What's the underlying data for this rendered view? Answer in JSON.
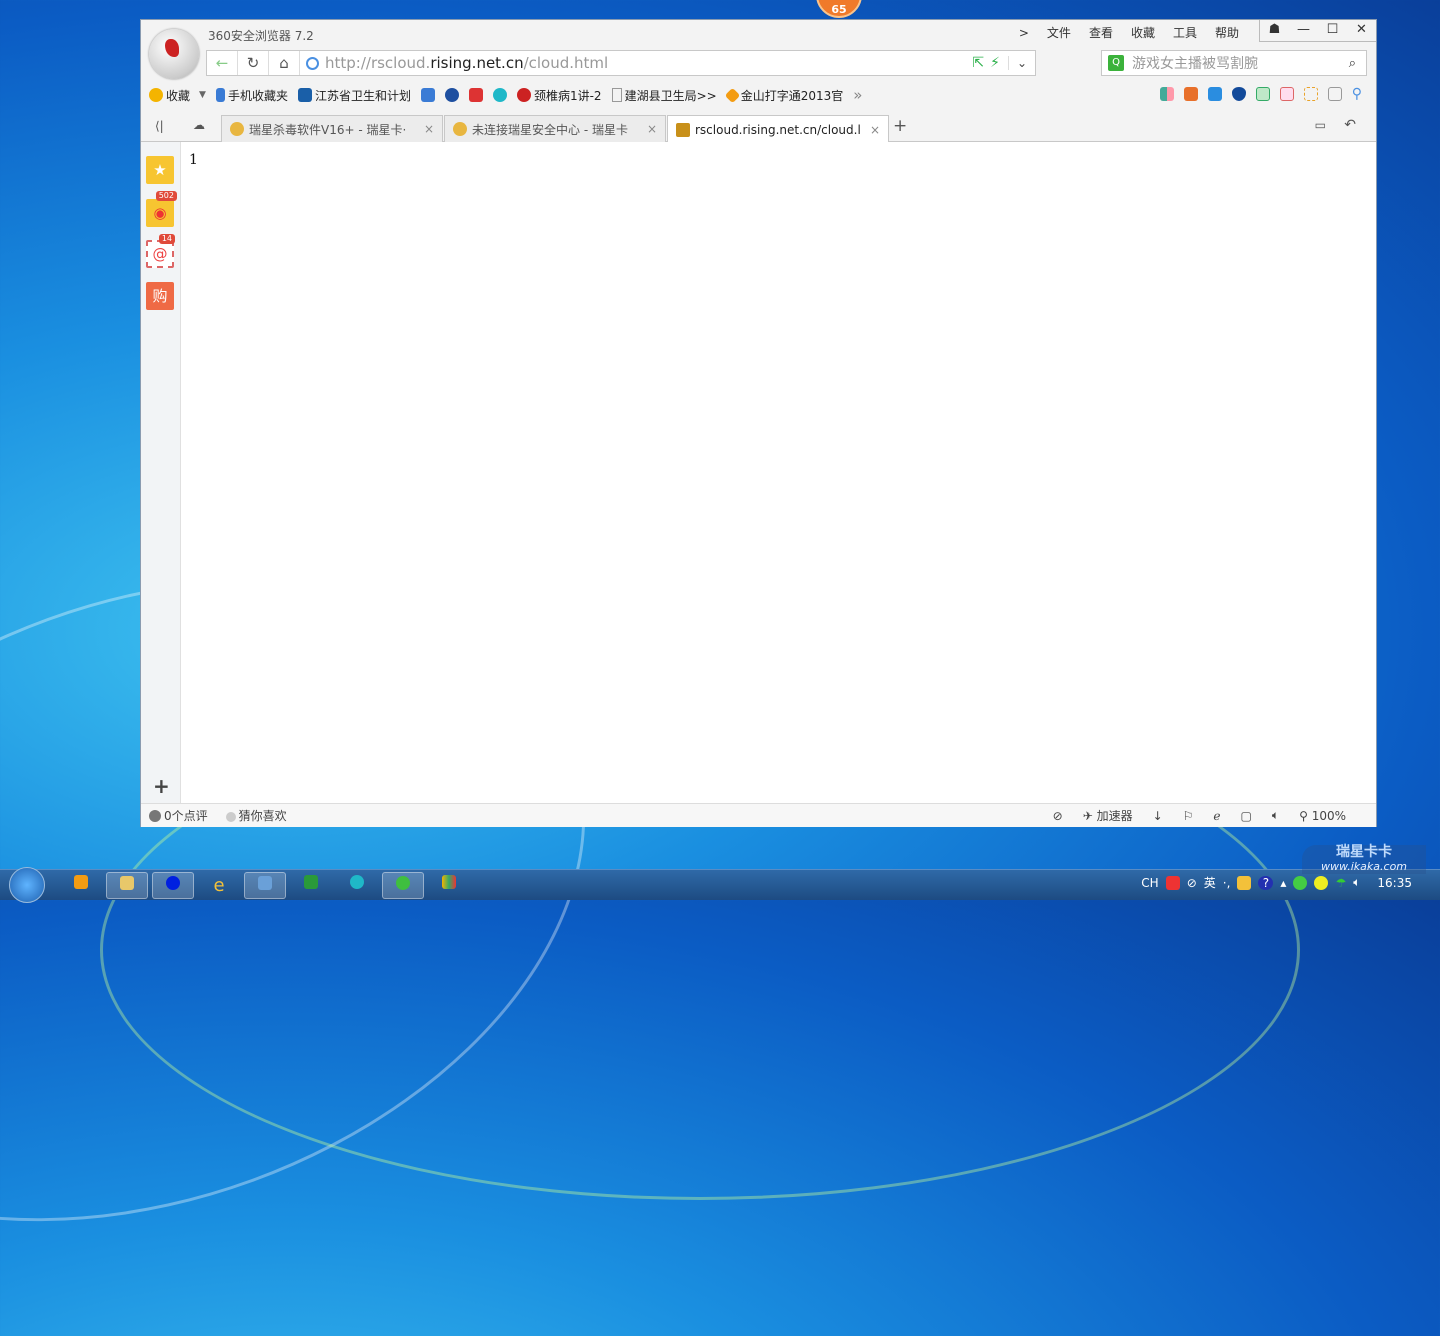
{
  "window": {
    "title": "360安全浏览器 7.2",
    "menu": [
      "文件",
      "查看",
      "收藏",
      "工具",
      "帮助"
    ],
    "menu_arrow": ">",
    "buttons": [
      "☗",
      "—",
      "☐",
      "✕"
    ]
  },
  "notification_ball": "65",
  "address": {
    "url_prefix": "http://rscloud.",
    "url_domain": "rising.net.cn",
    "url_suffix": "/cloud.html"
  },
  "search": {
    "placeholder": "游戏女主播被骂割腕"
  },
  "bookmarks": [
    {
      "label": "收藏",
      "color": "#f4b400"
    },
    {
      "label": "手机收藏夹",
      "color": "#3a7bd5"
    },
    {
      "label": "江苏省卫生和计划",
      "color": "#1a5fa8"
    },
    {
      "label": "",
      "color": "#3a7bd5"
    },
    {
      "label": "",
      "color": "#1e4fa0"
    },
    {
      "label": "",
      "color": "#d33"
    },
    {
      "label": "",
      "color": "#1fb8c8"
    },
    {
      "label": "颈椎病1讲-2",
      "color": "#c22"
    },
    {
      "label": "建湖县卫生局>>",
      "color": "#bbb"
    },
    {
      "label": "金山打字通2013官",
      "color": "#f39c12"
    }
  ],
  "bookmarks_more": "»",
  "tabs": [
    {
      "label": "瑞星杀毒软件V16+ - 瑞星卡·",
      "active": false
    },
    {
      "label": "未连接瑞星安全中心 - 瑞星卡",
      "active": false
    },
    {
      "label": "rscloud.rising.net.cn/cloud.l",
      "active": true
    }
  ],
  "new_tab": "+",
  "sidebar": {
    "items": [
      {
        "name": "favorites",
        "badge": ""
      },
      {
        "name": "weibo",
        "badge": "502"
      },
      {
        "name": "mail",
        "badge": "14"
      },
      {
        "name": "shopping",
        "badge": "",
        "label": "购"
      }
    ],
    "add": "+"
  },
  "page": {
    "content": "1"
  },
  "status": {
    "reviews": "0个点评",
    "guess": "猜你喜欢",
    "accelerator": "加速器",
    "zoom": "100%"
  },
  "tray": {
    "lang": "CH",
    "ime": "英",
    "time": "16:35"
  },
  "watermark": {
    "title": "瑞星卡卡",
    "url": "www.ikaka.com"
  }
}
